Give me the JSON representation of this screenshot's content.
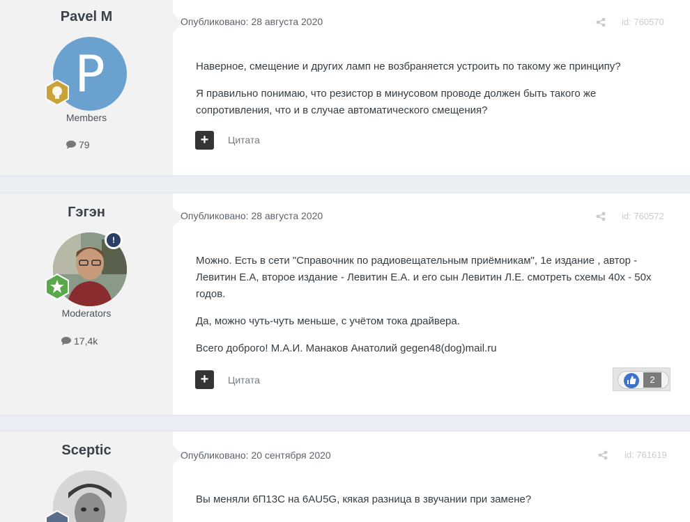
{
  "posts": [
    {
      "author": "Pavel M",
      "avatar_letter": "P",
      "group": "Members",
      "post_count": "79",
      "date": "Опубликовано: 28 августа 2020",
      "id": "id: 760570",
      "paragraphs": [
        "Наверное, смещение и других ламп не возбраняется устроить по такому же принципу?",
        "Я правильно понимаю, что резистор в минусовом проводе должен быть такого же сопротивления, что и в случае автоматического смещения?"
      ],
      "quote_label": "Цитата"
    },
    {
      "author": "Гэгэн",
      "group": "Moderators",
      "post_count": "17,4k",
      "date": "Опубликовано: 28 августа 2020",
      "id": "id: 760572",
      "paragraphs": [
        "Можно. Есть в сети \"Справочник по радиовещательным приёмникам\", 1е издание , автор  - Левитин Е.А, второе издание  -  Левитин Е.А. и его сын Левитин  Л.Е.  смотреть схемы 40х - 50х годов.",
        "Да, можно чуть-чуть меньше, с учётом тока драйвера.",
        "Всего доброго!   М.А.И.  Манаков Анатолий   gegen48(dog)mail.ru"
      ],
      "quote_label": "Цитата",
      "reactions": "2",
      "mod_badge": "!"
    },
    {
      "author": "Sceptic",
      "date": "Опубликовано: 20 сентября 2020",
      "id": "id: 761619",
      "paragraphs": [
        "Вы меняли 6П13С на 6AU5G,  кякая разница в звучании при замене?"
      ]
    }
  ],
  "colors": {
    "avatar_blue": "#6aa1cf",
    "rank_gold": "#c9a23a",
    "rank_green": "#5aa84a",
    "like_blue": "#3b73c8"
  },
  "icons": {
    "share": "share-icon",
    "comments": "comment-icon",
    "rank": "rank-badge-icon",
    "like": "thumbs-up-icon"
  }
}
